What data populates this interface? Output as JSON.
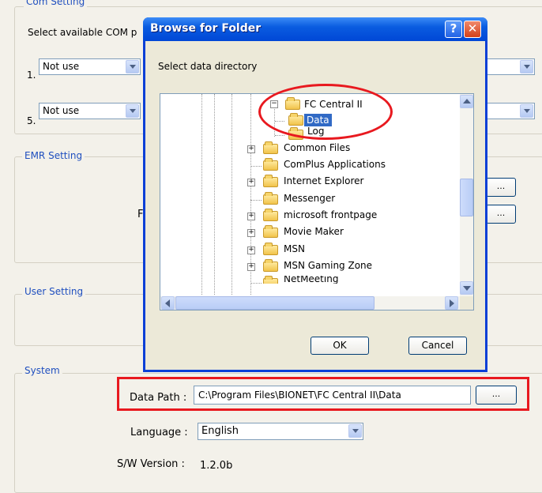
{
  "main": {
    "com_setting_title": "Com Setting",
    "com_select_label": "Select available COM p",
    "ports": [
      {
        "number": "1.",
        "value": "Not use"
      },
      {
        "number": "5.",
        "value": "Not use"
      }
    ],
    "emr_title": "EMR Setting",
    "emr_partial_label": "F",
    "browse_label": "...",
    "user_title": "User Setting",
    "system_title": "System",
    "data_path_label": "Data Path :",
    "data_path_value": "C:\\Program Files\\BIONET\\FC Central II\\Data",
    "language_label": "Language :",
    "language_value": "English",
    "version_label": "S/W Version :",
    "version_value": "1.2.0b"
  },
  "dialog": {
    "title": "Browse for Folder",
    "help_label": "?",
    "close_label": "✕",
    "prompt": "Select data directory",
    "tree": [
      {
        "label": "FC Central II",
        "expander": "−",
        "selected": false
      },
      {
        "label": "Data",
        "expander": "",
        "selected": true
      },
      {
        "label": "Log",
        "expander": "",
        "selected": false
      },
      {
        "label": "Common Files",
        "expander": "+",
        "selected": false
      },
      {
        "label": "ComPlus Applications",
        "expander": "",
        "selected": false
      },
      {
        "label": "Internet Explorer",
        "expander": "+",
        "selected": false
      },
      {
        "label": "Messenger",
        "expander": "",
        "selected": false
      },
      {
        "label": "microsoft frontpage",
        "expander": "+",
        "selected": false
      },
      {
        "label": "Movie Maker",
        "expander": "+",
        "selected": false
      },
      {
        "label": "MSN",
        "expander": "+",
        "selected": false
      },
      {
        "label": "MSN Gaming Zone",
        "expander": "+",
        "selected": false
      },
      {
        "label": "NetMeeting",
        "expander": "",
        "selected": false
      }
    ],
    "ok_label": "OK",
    "cancel_label": "Cancel"
  },
  "colors": {
    "highlight_red": "#e8191f",
    "selection_blue": "#316ac5",
    "group_title_blue": "#1f4fbf"
  }
}
